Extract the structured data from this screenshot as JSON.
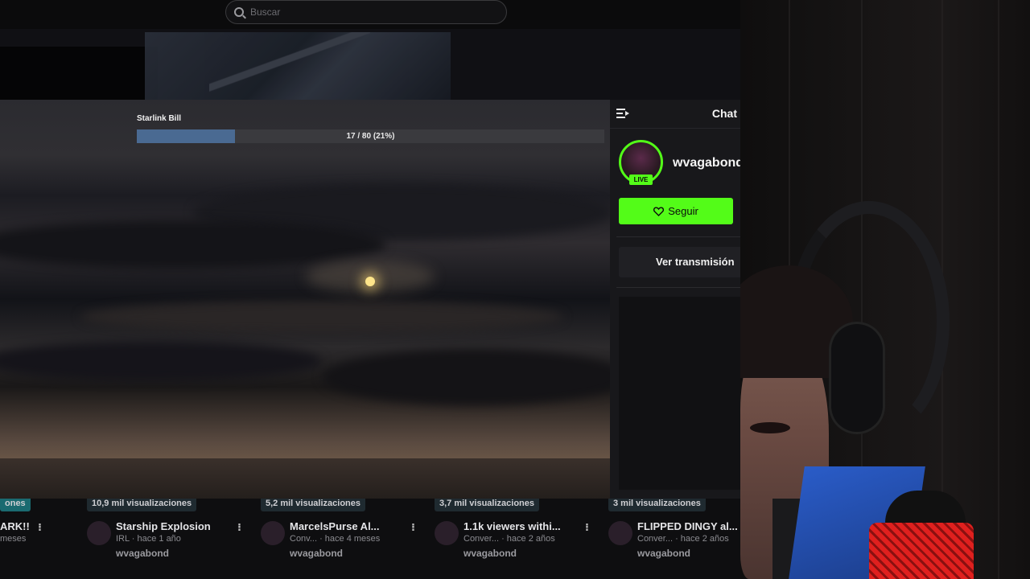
{
  "search": {
    "placeholder": "Buscar"
  },
  "goal": {
    "label": "Starlink Bill",
    "current": 17,
    "target": 80,
    "percent": 21,
    "text": "17 / 80 (21%)",
    "fill_color": "#4a6a92"
  },
  "chat": {
    "title": "Chat",
    "channel_name": "wvagabond",
    "live_badge": "LIVE",
    "follow_label": "Seguir",
    "watch_label": "Ver transmisión",
    "accent": "#53fc18"
  },
  "thumbnails": [
    {
      "views": "ones",
      "title": "ARK!!",
      "meta": "meses",
      "channel": ""
    },
    {
      "views": "10,9 mil visualizaciones",
      "title": "Starship Explosion",
      "meta": "IRL · hace 1 año",
      "channel": "wvagabond"
    },
    {
      "views": "5,2 mil visualizaciones",
      "title": "MarcelsPurse Al...",
      "meta": "Conv... · hace 4 meses",
      "channel": "wvagabond"
    },
    {
      "views": "3,7 mil visualizaciones",
      "title": "1.1k viewers withi...",
      "meta": "Conver... · hace 2 años",
      "channel": "wvagabond"
    },
    {
      "views": "3 mil visualizaciones",
      "title": "FLIPPED DINGY al...",
      "meta": "Conver... · hace 2 años",
      "channel": "wvagabond"
    }
  ],
  "icons": {
    "search": "search-icon",
    "collapse": "collapse-chat-icon",
    "heart": "heart-icon",
    "kebab": "more-options-icon"
  }
}
